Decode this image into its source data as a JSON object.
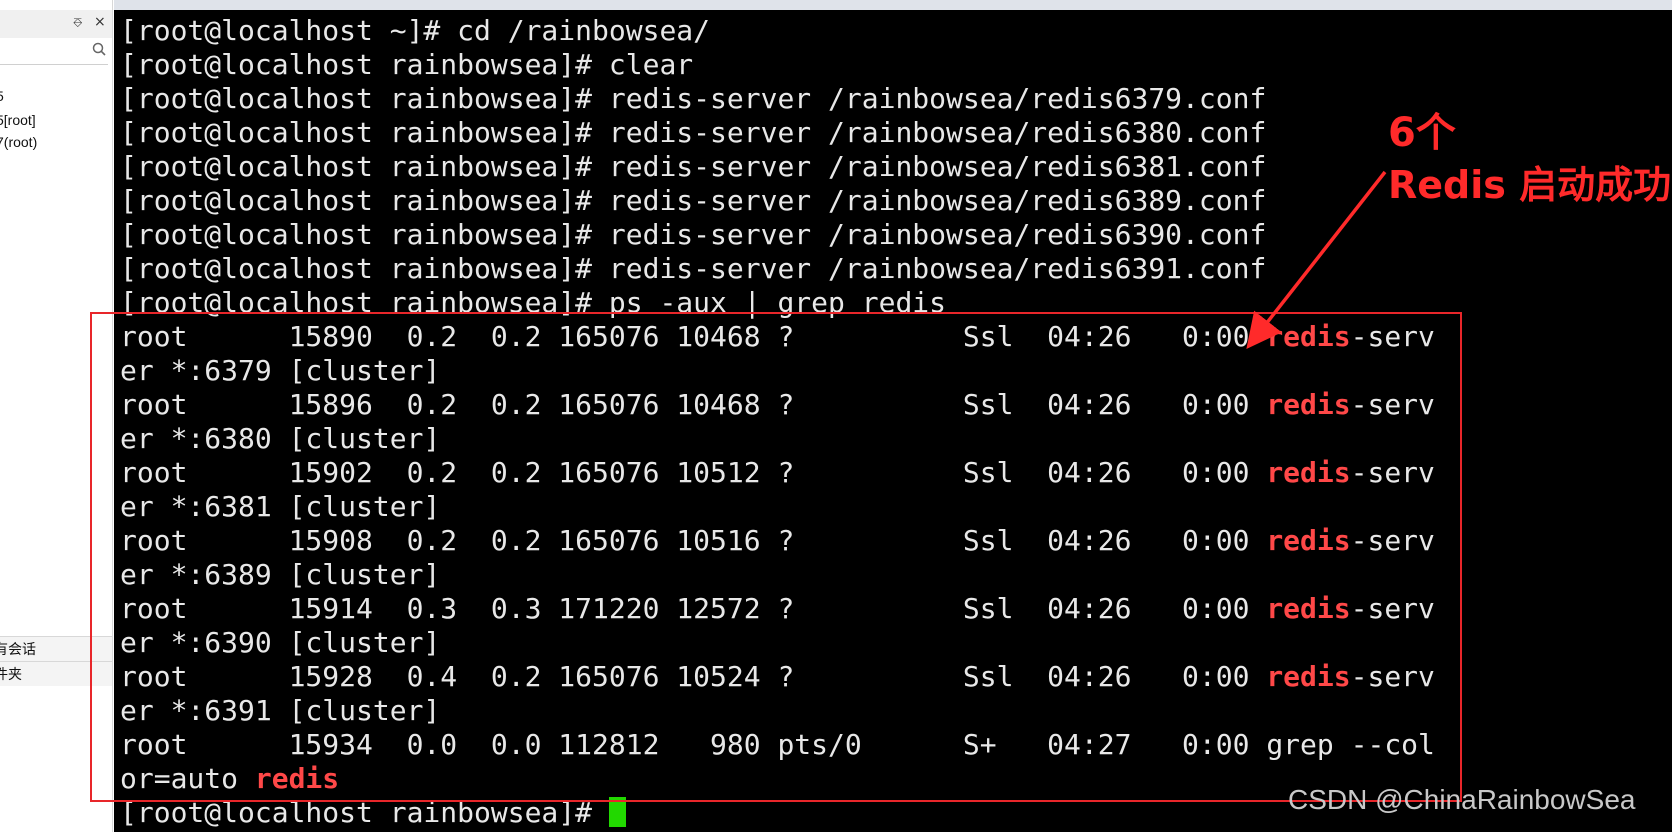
{
  "sidebar": {
    "pin_glyph": "⎑",
    "close_glyph": "×",
    "sessions": [
      "5",
      "5[root]",
      "7(root)"
    ],
    "bottom_items": [
      "有会话",
      "件夹"
    ]
  },
  "terminal": {
    "cd_line": "[root@localhost ~]# cd /rainbowsea/",
    "clear_line": "[root@localhost rainbowsea]# clear",
    "prompt": "[root@localhost rainbowsea]# ",
    "start_commands": [
      "redis-server /rainbowsea/redis6379.conf",
      "redis-server /rainbowsea/redis6380.conf",
      "redis-server /rainbowsea/redis6381.conf",
      "redis-server /rainbowsea/redis6389.conf",
      "redis-server /rainbowsea/redis6390.conf",
      "redis-server /rainbowsea/redis6391.conf"
    ],
    "ps_command": "ps -aux | grep redis",
    "processes": [
      {
        "user": "root",
        "pid": "15890",
        "cpu": "0.2",
        "mem": "0.2",
        "vsz": "165076",
        "rss": "10468",
        "tty": "?",
        "stat": "Ssl",
        "start": "04:26",
        "time": "0:00",
        "cmd_hl": "redis",
        "cmd_rest": "-serv",
        "cont": "er *:6379 [cluster]"
      },
      {
        "user": "root",
        "pid": "15896",
        "cpu": "0.2",
        "mem": "0.2",
        "vsz": "165076",
        "rss": "10468",
        "tty": "?",
        "stat": "Ssl",
        "start": "04:26",
        "time": "0:00",
        "cmd_hl": "redis",
        "cmd_rest": "-serv",
        "cont": "er *:6380 [cluster]"
      },
      {
        "user": "root",
        "pid": "15902",
        "cpu": "0.2",
        "mem": "0.2",
        "vsz": "165076",
        "rss": "10512",
        "tty": "?",
        "stat": "Ssl",
        "start": "04:26",
        "time": "0:00",
        "cmd_hl": "redis",
        "cmd_rest": "-serv",
        "cont": "er *:6381 [cluster]"
      },
      {
        "user": "root",
        "pid": "15908",
        "cpu": "0.2",
        "mem": "0.2",
        "vsz": "165076",
        "rss": "10516",
        "tty": "?",
        "stat": "Ssl",
        "start": "04:26",
        "time": "0:00",
        "cmd_hl": "redis",
        "cmd_rest": "-serv",
        "cont": "er *:6389 [cluster]"
      },
      {
        "user": "root",
        "pid": "15914",
        "cpu": "0.3",
        "mem": "0.3",
        "vsz": "171220",
        "rss": "12572",
        "tty": "?",
        "stat": "Ssl",
        "start": "04:26",
        "time": "0:00",
        "cmd_hl": "redis",
        "cmd_rest": "-serv",
        "cont": "er *:6390 [cluster]"
      },
      {
        "user": "root",
        "pid": "15928",
        "cpu": "0.4",
        "mem": "0.2",
        "vsz": "165076",
        "rss": "10524",
        "tty": "?",
        "stat": "Ssl",
        "start": "04:26",
        "time": "0:00",
        "cmd_hl": "redis",
        "cmd_rest": "-serv",
        "cont": "er *:6391 [cluster]"
      }
    ],
    "grep_process": {
      "user": "root",
      "pid": "15934",
      "cpu": "0.0",
      "mem": "0.0",
      "vsz": "112812",
      "rss": "980",
      "tty": "pts/0",
      "stat": "S+",
      "start": "04:27",
      "time": "0:00",
      "cmd": "grep --col",
      "cont_prefix": "or=auto ",
      "cont_hl": "redis"
    }
  },
  "annotation": {
    "count_label": "6个",
    "status_label": "Redis 启动成功",
    "color": "#ff2a2a"
  },
  "watermark": "CSDN @ChinaRainbowSea"
}
